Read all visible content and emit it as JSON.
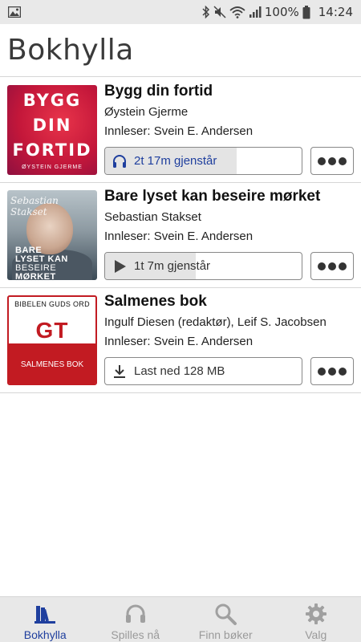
{
  "status_bar": {
    "battery": "100%",
    "time": "14:24",
    "icons": [
      "image-icon",
      "bluetooth-icon",
      "mute-icon",
      "wifi-icon",
      "signal-icon",
      "battery-icon"
    ]
  },
  "header": {
    "title": "Bokhylla"
  },
  "books": [
    {
      "title": "Bygg din fortid",
      "author": "Øystein Gjerme",
      "narrator": "Innleser: Svein E. Andersen",
      "action_label": "2t 17m gjenstår",
      "action_icon": "headphones-icon",
      "progress": 0.67,
      "cover": {
        "lines": [
          "BYGG",
          "DIN",
          "FORTID"
        ],
        "author": "ØYSTEIN GJERME"
      }
    },
    {
      "title": "Bare lyset kan beseire mørket",
      "author": "Sebastian Stakset",
      "narrator": "Innleser: Svein E. Andersen",
      "action_label": "1t 7m gjenstår",
      "action_icon": "play-icon",
      "progress": 0.46,
      "cover": {
        "lines": [
          "BARE",
          "LYSET KAN",
          "BESEIRE",
          "MØRKET"
        ],
        "signature": "Sebastian Stakset"
      }
    },
    {
      "title": "Salmenes bok",
      "author": "Ingulf Diesen (redaktør), Leif S. Jacobsen",
      "narrator": "Innleser: Svein E. Andersen",
      "action_label": "Last ned 128 MB",
      "action_icon": "download-icon",
      "progress": 0,
      "cover": {
        "top": "BIBELEN GUDS ORD",
        "big": "GT",
        "bottom": "SALMENES BOK"
      }
    }
  ],
  "nav": [
    {
      "label": "Bokhylla",
      "icon": "bookshelf-icon",
      "active": true
    },
    {
      "label": "Spilles nå",
      "icon": "headphones-icon",
      "active": false
    },
    {
      "label": "Finn bøker",
      "icon": "search-icon",
      "active": false
    },
    {
      "label": "Valg",
      "icon": "gear-icon",
      "active": false
    }
  ],
  "colors": {
    "accent": "#1f3f9e",
    "nav_inactive": "#9a9a9a",
    "cover_red": "#c21b22"
  }
}
